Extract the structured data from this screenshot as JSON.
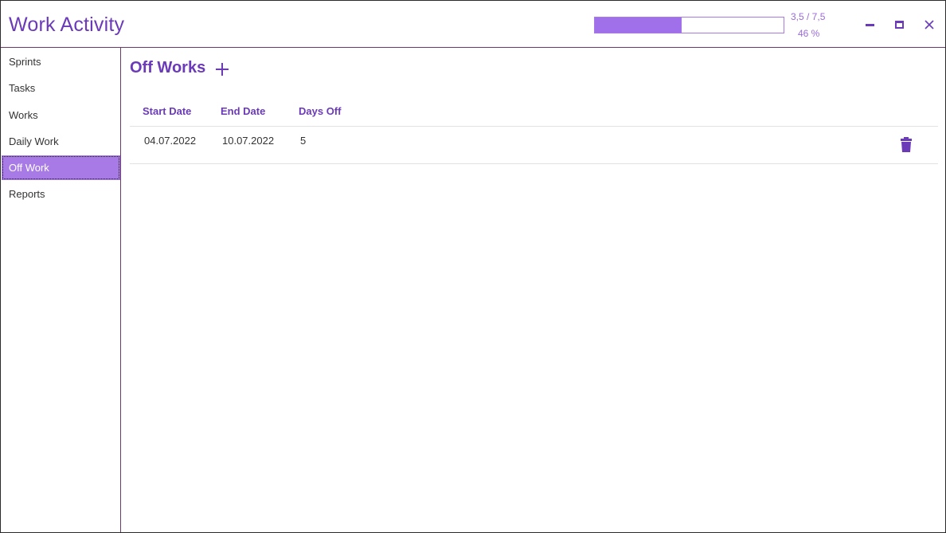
{
  "app": {
    "title": "Work Activity"
  },
  "progress": {
    "ratio_text": "3,5 / 7,5",
    "percent_text": "46 %",
    "fraction": 0.46
  },
  "window_controls": {
    "minimize_icon": "minimize-icon",
    "maximize_icon": "maximize-icon",
    "close_icon": "close-icon"
  },
  "sidebar": {
    "items": [
      {
        "label": "Sprints",
        "active": false
      },
      {
        "label": "Tasks",
        "active": false
      },
      {
        "label": "Works",
        "active": false
      },
      {
        "label": "Daily Work",
        "active": false
      },
      {
        "label": "Off Work",
        "active": true
      },
      {
        "label": "Reports",
        "active": false
      }
    ]
  },
  "main": {
    "title": "Off Works",
    "add_icon": "plus-icon",
    "table": {
      "headers": [
        "Start Date",
        "End Date",
        "Days Off"
      ],
      "rows": [
        {
          "start_date": "04.07.2022",
          "end_date": "10.07.2022",
          "days_off": "5",
          "action_icon": "trash-icon"
        }
      ]
    }
  },
  "colors": {
    "accent": "#6a3ab8",
    "accent_light": "#a77ae6",
    "progress_fill": "#a070ea"
  }
}
